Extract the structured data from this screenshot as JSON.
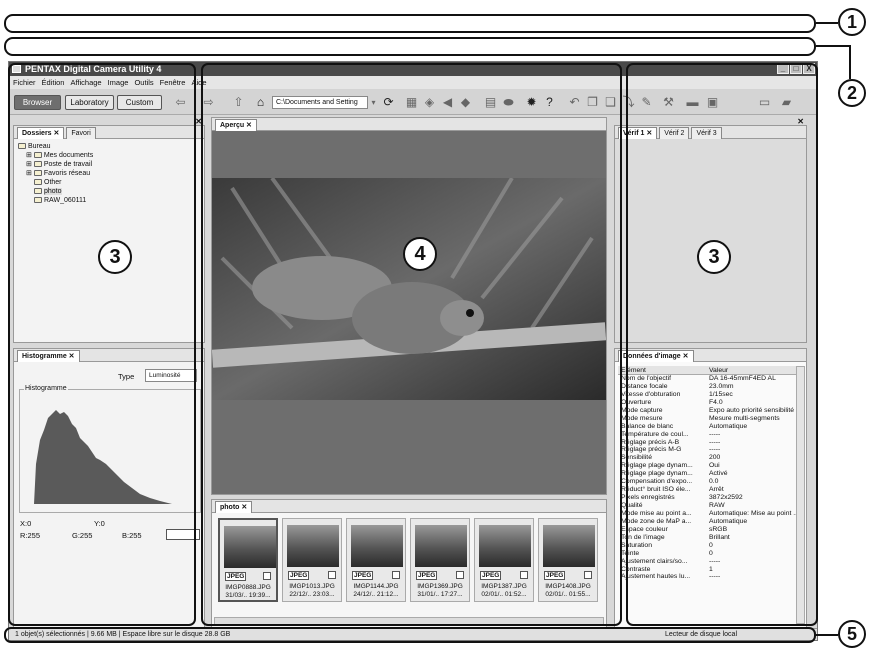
{
  "callouts": {
    "c1": "1",
    "c2": "2",
    "c3a": "3",
    "c3b": "3",
    "c4": "4",
    "c5": "5"
  },
  "app": {
    "title": "PENTAX Digital Camera Utility 4",
    "window_buttons": {
      "minimize": "_",
      "maximize": "□",
      "close": "X"
    }
  },
  "menu": [
    "Fichier",
    "Édition",
    "Affichage",
    "Image",
    "Outils",
    "Fenêtre",
    "Aide"
  ],
  "toolbar": {
    "modes": [
      "Browser",
      "Laboratory",
      "Custom"
    ],
    "address": "C:\\Documents and Setting"
  },
  "left_top": {
    "tabs": [
      "Dossiers ✕",
      "Favori"
    ],
    "tree": [
      "Bureau",
      "Mes documents",
      "Poste de travail",
      "Favoris réseau",
      "Other",
      "photo",
      "RAW_060111"
    ]
  },
  "histogram": {
    "tab": "Histogramme ✕",
    "type_label": "Type",
    "type_value": "Luminosité",
    "group_label": "Histogramme",
    "x": "X:0",
    "y": "Y:0",
    "r": "R:255",
    "g": "G:255",
    "b": "B:255"
  },
  "preview": {
    "tab": "Aperçu ✕"
  },
  "filmstrip": {
    "tab": "photo ✕",
    "badge": "JPEG",
    "thumbs": [
      {
        "name": "IMGP0888.JPG",
        "date": "31/03/..  19:39..."
      },
      {
        "name": "IMGP1013.JPG",
        "date": "22/12/..  23:03..."
      },
      {
        "name": "IMGP1144.JPG",
        "date": "24/12/..  21:12..."
      },
      {
        "name": "IMGP1369.JPG",
        "date": "31/01/..  17:27..."
      },
      {
        "name": "IMGP1387.JPG",
        "date": "02/01/..  01:52..."
      },
      {
        "name": "IMGP1408.JPG",
        "date": "02/01/..  01:55..."
      }
    ]
  },
  "verif": {
    "tabs": [
      "Vérif 1 ✕",
      "Vérif 2",
      "Vérif 3"
    ]
  },
  "image_data": {
    "tab": "Données d'image ✕",
    "headers": [
      "Elément",
      "Valeur"
    ],
    "rows": [
      [
        "Nom de l'objectif",
        "DA 16-45mmF4ED AL"
      ],
      [
        "Distance focale",
        "23.0mm"
      ],
      [
        "Vitesse d'obturation",
        "1/15sec"
      ],
      [
        "Ouverture",
        "F4.0"
      ],
      [
        "Mode capture",
        "Expo auto priorité sensibilité"
      ],
      [
        "Mode mesure",
        "Mesure multi-segments"
      ],
      [
        "Balance de blanc",
        "Automatique"
      ],
      [
        "Température de coul...",
        "-----"
      ],
      [
        "Réglage précis A-B",
        "-----"
      ],
      [
        "Réglage précis M-G",
        "-----"
      ],
      [
        "Sensibilité",
        "200"
      ],
      [
        "Réglage plage dynam...",
        "Oui"
      ],
      [
        "Réglage plage dynam...",
        "Activé"
      ],
      [
        "Compensation d'expo...",
        "0.0"
      ],
      [
        "Réduct° bruit ISO éle...",
        "Arrêt"
      ],
      [
        "Pixels enregistrés",
        "3872x2592"
      ],
      [
        "Qualité",
        "RAW"
      ],
      [
        "Mode mise au point a...",
        "Automatique: Mise au point ..."
      ],
      [
        "Mode zone de MaP a...",
        "Automatique"
      ],
      [
        "Espace couleur",
        "sRGB"
      ],
      [
        "Ton de l'image",
        "Brillant"
      ],
      [
        "Saturation",
        "0"
      ],
      [
        "Teinte",
        "0"
      ],
      [
        "Ajustement clairs/so...",
        "-----"
      ],
      [
        "Contraste",
        "1"
      ],
      [
        "Ajustement hautes lu...",
        "-----"
      ]
    ]
  },
  "status": {
    "left": "1 objet(s) sélectionnés | 9.66 MB | Espace libre sur le disque 28.8 GB",
    "right": "Lecteur de disque local"
  }
}
